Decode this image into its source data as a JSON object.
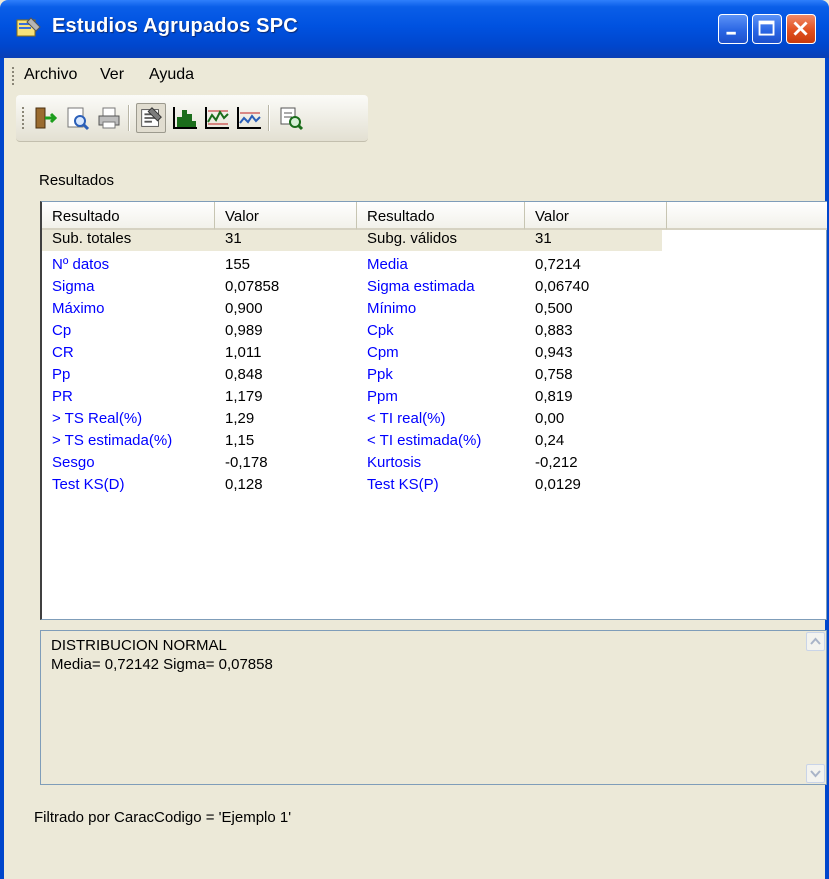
{
  "window": {
    "title": "Estudios Agrupados SPC"
  },
  "menu": {
    "items": [
      "Archivo",
      "Ver",
      "Ayuda"
    ]
  },
  "toolbar": {
    "buttons": [
      "exit-icon",
      "print-preview-icon",
      "print-icon",
      "results-icon",
      "histogram-icon",
      "chart-xbar-icon",
      "chart-range-icon",
      "explore-icon"
    ]
  },
  "results": {
    "group_label": "Resultados",
    "columns": [
      "Resultado",
      "Valor",
      "Resultado",
      "Valor"
    ],
    "rows": [
      {
        "l1": "Sub. totales",
        "v1": "31",
        "l2": "Subg. válidos",
        "v2": "31"
      },
      {
        "l1": "Nº datos",
        "v1": "155",
        "l2": "Media",
        "v2": "0,7214"
      },
      {
        "l1": "Sigma",
        "v1": "0,07858",
        "l2": "Sigma estimada",
        "v2": "0,06740"
      },
      {
        "l1": "Máximo",
        "v1": "0,900",
        "l2": "Mínimo",
        "v2": "0,500"
      },
      {
        "l1": "Cp",
        "v1": "0,989",
        "l2": "Cpk",
        "v2": "0,883"
      },
      {
        "l1": "CR",
        "v1": "1,011",
        "l2": "Cpm",
        "v2": "0,943"
      },
      {
        "l1": "Pp",
        "v1": "0,848",
        "l2": "Ppk",
        "v2": "0,758"
      },
      {
        "l1": "PR",
        "v1": "1,179",
        "l2": "Ppm",
        "v2": "0,819"
      },
      {
        "l1": "> TS Real(%)",
        "v1": "1,29",
        "l2": "< TI real(%)",
        "v2": "0,00"
      },
      {
        "l1": "> TS estimada(%)",
        "v1": "1,15",
        "l2": "< TI estimada(%)",
        "v2": "0,24"
      },
      {
        "l1": "Sesgo",
        "v1": "-0,178",
        "l2": "Kurtosis",
        "v2": "-0,212"
      },
      {
        "l1": "Test KS(D)",
        "v1": "0,128",
        "l2": "Test KS(P)",
        "v2": "0,0129"
      }
    ]
  },
  "info": {
    "lines": [
      "DISTRIBUCION NORMAL",
      "Media= 0,72142 Sigma= 0,07858"
    ]
  },
  "status": {
    "filter_text": "Filtrado por CaracCodigo = 'Ejemplo 1'"
  },
  "colors": {
    "title_blue": "#0046cc",
    "label_blue": "#0000ff",
    "close_red": "#e1501f"
  }
}
